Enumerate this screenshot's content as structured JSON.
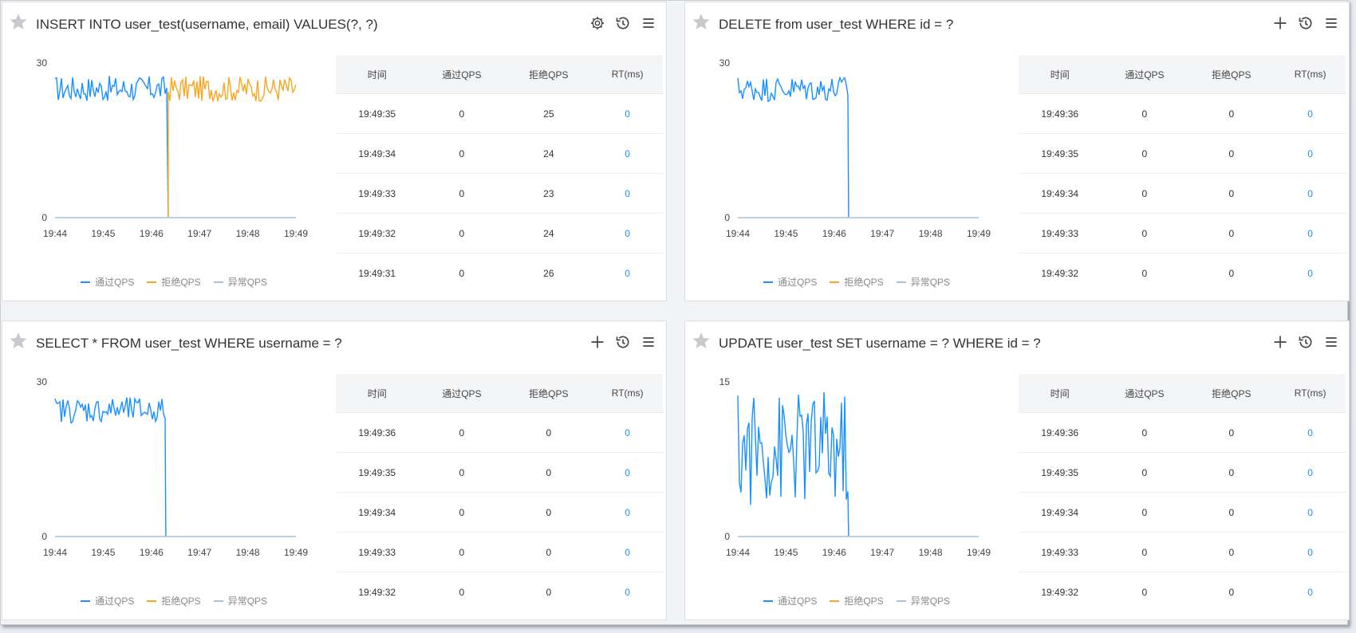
{
  "legend": {
    "pass": "通过QPS",
    "block": "拒绝QPS",
    "exception": "异常QPS"
  },
  "colors": {
    "pass": "#1890ff",
    "block": "#f5a623",
    "exception": "#a6bfdc"
  },
  "table_headers": {
    "time": "时间",
    "pass": "通过QPS",
    "block": "拒绝QPS",
    "rt": "RT(ms)"
  },
  "panels": [
    {
      "title": "INSERT INTO user_test(username, email) VALUES(?, ?)",
      "icons": [
        "gear-icon",
        "history-icon",
        "menu-icon"
      ],
      "rows": [
        {
          "time": "19:49:35",
          "pass": "0",
          "block": "25",
          "rt": "0"
        },
        {
          "time": "19:49:34",
          "pass": "0",
          "block": "24",
          "rt": "0"
        },
        {
          "time": "19:49:33",
          "pass": "0",
          "block": "23",
          "rt": "0"
        },
        {
          "time": "19:49:32",
          "pass": "0",
          "block": "24",
          "rt": "0"
        },
        {
          "time": "19:49:31",
          "pass": "0",
          "block": "26",
          "rt": "0"
        }
      ],
      "chart_data": {
        "type": "line",
        "x_ticks": [
          "19:44",
          "19:45",
          "19:46",
          "19:47",
          "19:48",
          "19:49"
        ],
        "y_ticks": [
          "0",
          "30"
        ],
        "ylim": [
          0,
          30
        ],
        "series": [
          {
            "name": "通过QPS",
            "segment": [
              0,
              0.47
            ],
            "level": 25,
            "amp": 2.5,
            "drop_to": 0
          },
          {
            "name": "拒绝QPS",
            "segment": [
              0.47,
              1.0
            ],
            "level": 25,
            "amp": 2.5,
            "from": 0
          },
          {
            "name": "异常QPS",
            "segment": [
              0,
              1.0
            ],
            "level": 0,
            "amp": 0
          }
        ]
      }
    },
    {
      "title": "DELETE from user_test WHERE id = ?",
      "icons": [
        "plus-icon",
        "history-icon",
        "menu-icon"
      ],
      "rows": [
        {
          "time": "19:49:36",
          "pass": "0",
          "block": "0",
          "rt": "0"
        },
        {
          "time": "19:49:35",
          "pass": "0",
          "block": "0",
          "rt": "0"
        },
        {
          "time": "19:49:34",
          "pass": "0",
          "block": "0",
          "rt": "0"
        },
        {
          "time": "19:49:33",
          "pass": "0",
          "block": "0",
          "rt": "0"
        },
        {
          "time": "19:49:32",
          "pass": "0",
          "block": "0",
          "rt": "0"
        }
      ],
      "chart_data": {
        "type": "line",
        "x_ticks": [
          "19:44",
          "19:45",
          "19:46",
          "19:47",
          "19:48",
          "19:49"
        ],
        "y_ticks": [
          "0",
          "30"
        ],
        "ylim": [
          0,
          30
        ],
        "series": [
          {
            "name": "通过QPS",
            "segment": [
              0,
              0.46
            ],
            "level": 25,
            "amp": 2.5,
            "drop_to": 0
          },
          {
            "name": "异常QPS",
            "segment": [
              0,
              1.0
            ],
            "level": 0,
            "amp": 0
          }
        ]
      }
    },
    {
      "title": "SELECT * FROM user_test WHERE username = ?",
      "icons": [
        "plus-icon",
        "history-icon",
        "menu-icon"
      ],
      "rows": [
        {
          "time": "19:49:36",
          "pass": "0",
          "block": "0",
          "rt": "0"
        },
        {
          "time": "19:49:35",
          "pass": "0",
          "block": "0",
          "rt": "0"
        },
        {
          "time": "19:49:34",
          "pass": "0",
          "block": "0",
          "rt": "0"
        },
        {
          "time": "19:49:33",
          "pass": "0",
          "block": "0",
          "rt": "0"
        },
        {
          "time": "19:49:32",
          "pass": "0",
          "block": "0",
          "rt": "0"
        }
      ],
      "chart_data": {
        "type": "line",
        "x_ticks": [
          "19:44",
          "19:45",
          "19:46",
          "19:47",
          "19:48",
          "19:49"
        ],
        "y_ticks": [
          "0",
          "30"
        ],
        "ylim": [
          0,
          30
        ],
        "series": [
          {
            "name": "通过QPS",
            "segment": [
              0,
              0.46
            ],
            "level": 24.5,
            "amp": 2.5,
            "drop_to": 0
          },
          {
            "name": "异常QPS",
            "segment": [
              0,
              1.0
            ],
            "level": 0,
            "amp": 0
          }
        ]
      }
    },
    {
      "title": "UPDATE user_test SET username = ? WHERE id = ?",
      "icons": [
        "plus-icon",
        "history-icon",
        "menu-icon"
      ],
      "rows": [
        {
          "time": "19:49:36",
          "pass": "0",
          "block": "0",
          "rt": "0"
        },
        {
          "time": "19:49:35",
          "pass": "0",
          "block": "0",
          "rt": "0"
        },
        {
          "time": "19:49:34",
          "pass": "0",
          "block": "0",
          "rt": "0"
        },
        {
          "time": "19:49:33",
          "pass": "0",
          "block": "0",
          "rt": "0"
        },
        {
          "time": "19:49:32",
          "pass": "0",
          "block": "0",
          "rt": "0"
        }
      ],
      "chart_data": {
        "type": "line",
        "x_ticks": [
          "19:44",
          "19:45",
          "19:46",
          "19:47",
          "19:48",
          "19:49"
        ],
        "y_ticks": [
          "0",
          "15"
        ],
        "ylim": [
          0,
          15
        ],
        "series": [
          {
            "name": "通过QPS",
            "segment": [
              0,
              0.46
            ],
            "level": 8.5,
            "amp": 5.5,
            "drop_to": 0
          },
          {
            "name": "异常QPS",
            "segment": [
              0,
              1.0
            ],
            "level": 0,
            "amp": 0
          }
        ]
      }
    }
  ]
}
